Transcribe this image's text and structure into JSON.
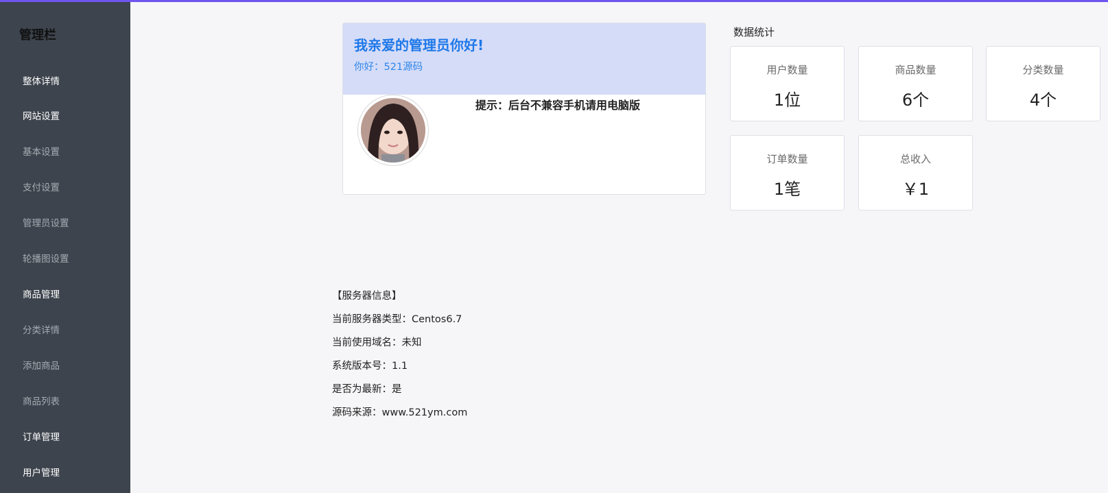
{
  "sidebar": {
    "title": "管理栏",
    "items": [
      {
        "label": "整体详情",
        "type": "main"
      },
      {
        "label": "网站设置",
        "type": "main"
      },
      {
        "label": "基本设置",
        "type": "sub"
      },
      {
        "label": "支付设置",
        "type": "sub"
      },
      {
        "label": "管理员设置",
        "type": "sub"
      },
      {
        "label": "轮播图设置",
        "type": "sub"
      },
      {
        "label": "商品管理",
        "type": "main"
      },
      {
        "label": "分类详情",
        "type": "sub"
      },
      {
        "label": "添加商品",
        "type": "sub"
      },
      {
        "label": "商品列表",
        "type": "sub"
      },
      {
        "label": "订单管理",
        "type": "main"
      },
      {
        "label": "用户管理",
        "type": "main"
      }
    ]
  },
  "welcome": {
    "title": "我亲爱的管理员你好!",
    "greeting": "你好：521源码",
    "hint": "提示：后台不兼容手机请用电脑版"
  },
  "stats": {
    "title": "数据统计",
    "cards": [
      {
        "label": "用户数量",
        "value": "1位"
      },
      {
        "label": "商品数量",
        "value": "6个"
      },
      {
        "label": "分类数量",
        "value": "4个"
      },
      {
        "label": "订单数量",
        "value": "1笔"
      },
      {
        "label": "总收入",
        "value": "￥1"
      }
    ]
  },
  "server": {
    "heading": "【服务器信息】",
    "lines": [
      "当前服务器类型：Centos6.7",
      "当前使用域名：未知",
      "系统版本号：1.1",
      "是否为最新：是",
      "源码来源：www.521ym.com"
    ]
  },
  "colors": {
    "accent_bar": "#6f55f0",
    "sidebar_bg": "#3d444d",
    "welcome_head_bg": "#d5dcf8",
    "welcome_title": "#1e78e8"
  }
}
